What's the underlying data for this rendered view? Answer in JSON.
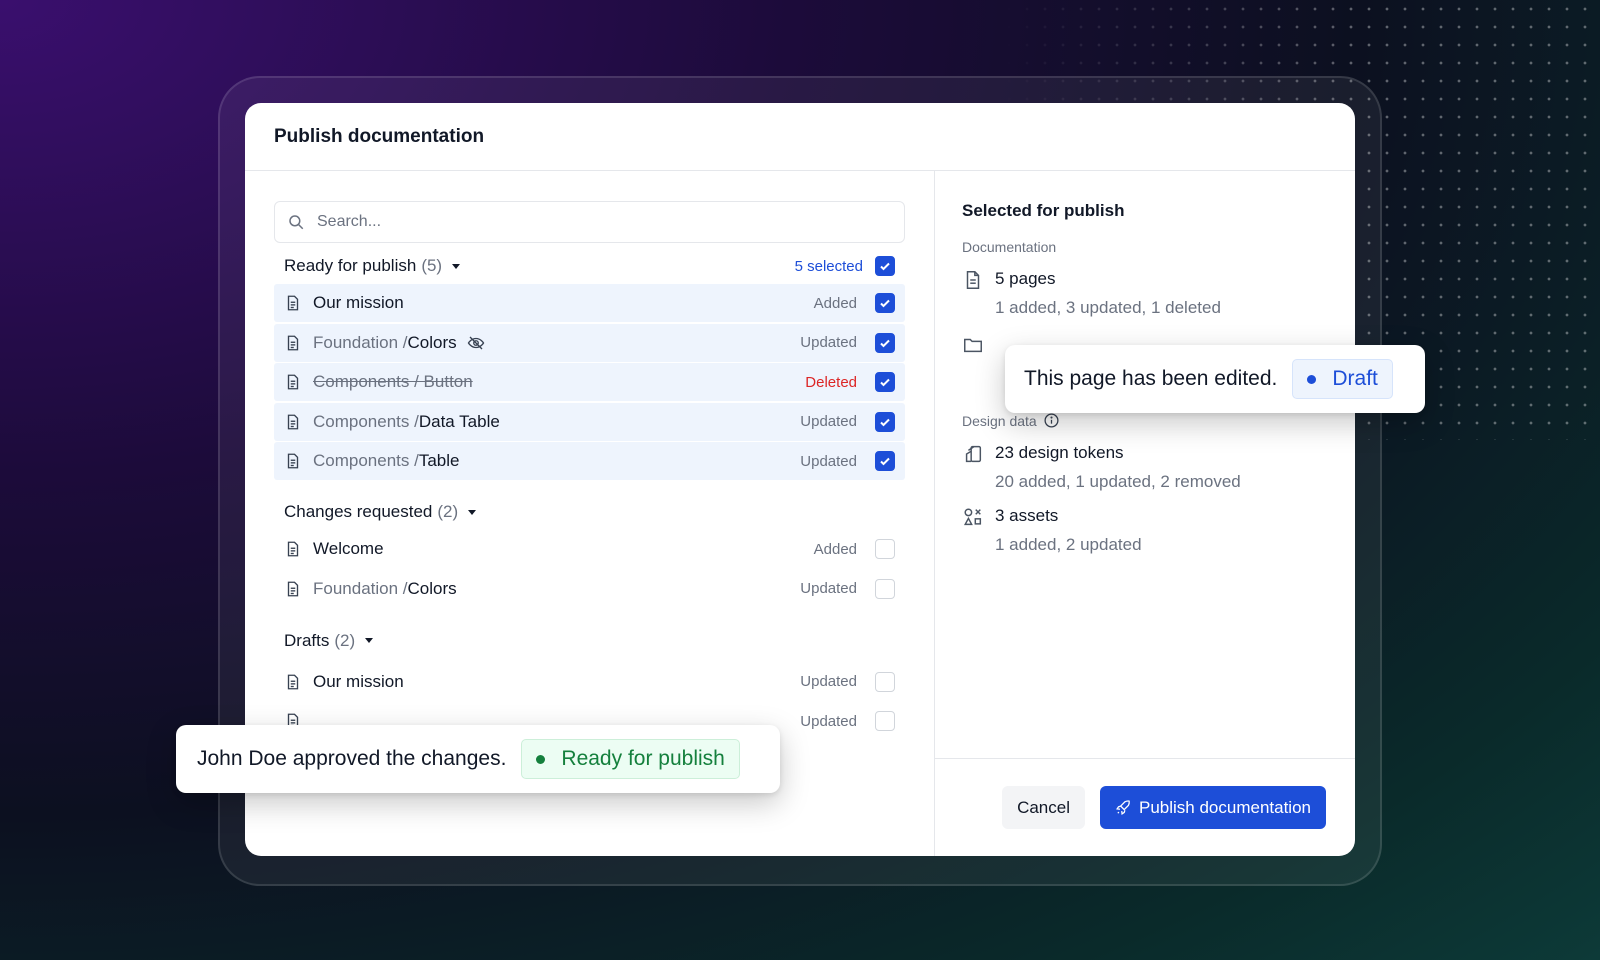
{
  "modal": {
    "title": "Publish documentation"
  },
  "search": {
    "placeholder": "Search..."
  },
  "groups": {
    "ready": {
      "label": "Ready for publish",
      "count": "(5)",
      "selected": "5 selected",
      "rows": [
        {
          "path": "",
          "name": "Our mission",
          "status": "Added"
        },
        {
          "path": "Foundation / ",
          "name": "Colors",
          "status": "Updated"
        },
        {
          "path": "",
          "name": "Components / Button",
          "status": "Deleted"
        },
        {
          "path": "Components / ",
          "name": "Data Table",
          "status": "Updated"
        },
        {
          "path": "Components / ",
          "name": "Table",
          "status": "Updated"
        }
      ]
    },
    "changes": {
      "label": "Changes requested",
      "count": "(2)",
      "rows": [
        {
          "path": "",
          "name": "Welcome",
          "status": "Added"
        },
        {
          "path": "Foundation / ",
          "name": "Colors",
          "status": "Updated"
        }
      ]
    },
    "drafts": {
      "label": "Drafts",
      "count": "(2)",
      "rows": [
        {
          "path": "",
          "name": "Our mission",
          "status": "Updated"
        },
        {
          "path": "",
          "name": "",
          "status": "Updated"
        }
      ]
    }
  },
  "summary": {
    "title": "Selected for publish",
    "documentation_label": "Documentation",
    "pages_title": "5 pages",
    "pages_detail": "1 added, 3 updated, 1 deleted",
    "design_label": "Design data",
    "tokens_title": "23 design tokens",
    "tokens_detail": "20 added, 1 updated, 2 removed",
    "assets_title": "3 assets",
    "assets_detail": "1 added, 2 updated"
  },
  "footer": {
    "cancel": "Cancel",
    "publish": "Publish documentation"
  },
  "toast_approved": {
    "user": "John Doe",
    "text": " approved the changes.",
    "pill": "Ready for publish"
  },
  "toast_edited": {
    "text": "This page has been edited.",
    "pill": "Draft"
  },
  "colors": {
    "accent": "#1d4ed8",
    "deleted": "#dc2626",
    "success": "#15803d"
  }
}
